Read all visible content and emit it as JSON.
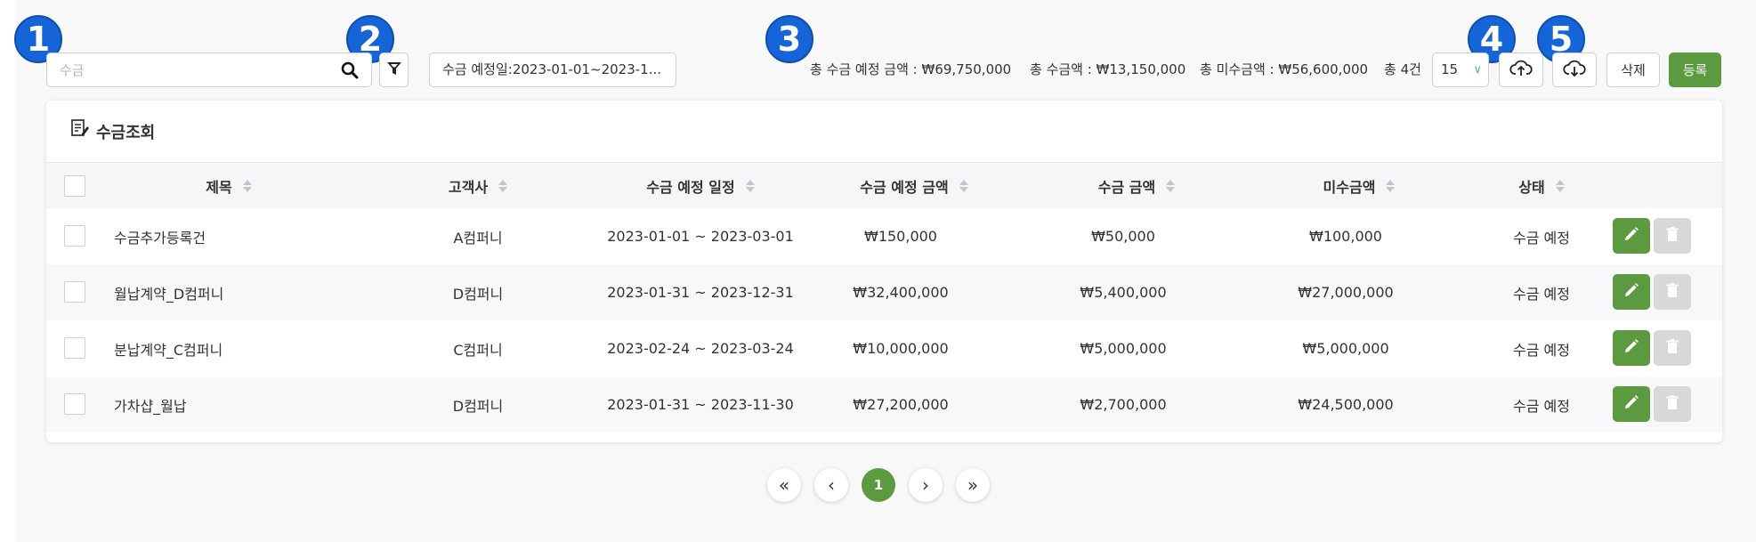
{
  "markers": [
    "1",
    "2",
    "3",
    "4",
    "5"
  ],
  "toolbar": {
    "search_placeholder": "수금",
    "search_value": "",
    "date_filter": "수금 예정일:2023-01-01~2023-1...",
    "summary": {
      "expected_total": "총 수금 예정 금액 : ₩69,750,000",
      "collected_total": "총 수금액 : ₩13,150,000",
      "outstanding_total": "총 미수금액 : ₩56,600,000",
      "count": "총 4건"
    },
    "page_size": "15",
    "delete_label": "삭제",
    "register_label": "등록",
    "upload_icon": "cloud-upload-icon",
    "download_icon": "cloud-download-icon",
    "accent_color": "#5b9a3e",
    "marker_color": "#1565d8"
  },
  "card": {
    "title": "수금조회",
    "columns": [
      "제목",
      "고객사",
      "수금 예정 일정",
      "수금 예정 금액",
      "수금 금액",
      "미수금액",
      "상태"
    ],
    "rows": [
      {
        "title": "수금추가등록건",
        "customer": "A컴퍼니",
        "schedule": "2023-01-01 ~ 2023-03-01",
        "expected": "₩150,000",
        "collected": "₩50,000",
        "outstanding": "₩100,000",
        "status": "수금 예정"
      },
      {
        "title": "월납계약_D컴퍼니",
        "customer": "D컴퍼니",
        "schedule": "2023-01-31 ~ 2023-12-31",
        "expected": "₩32,400,000",
        "collected": "₩5,400,000",
        "outstanding": "₩27,000,000",
        "status": "수금 예정"
      },
      {
        "title": "분납계약_C컴퍼니",
        "customer": "C컴퍼니",
        "schedule": "2023-02-24 ~ 2023-03-24",
        "expected": "₩10,000,000",
        "collected": "₩5,000,000",
        "outstanding": "₩5,000,000",
        "status": "수금 예정"
      },
      {
        "title": "가차샵_월납",
        "customer": "D컴퍼니",
        "schedule": "2023-01-31 ~ 2023-11-30",
        "expected": "₩27,200,000",
        "collected": "₩2,700,000",
        "outstanding": "₩24,500,000",
        "status": "수금 예정"
      }
    ]
  },
  "pagination": {
    "first": "«",
    "prev": "‹",
    "current": "1",
    "next": "›",
    "last": "»"
  }
}
